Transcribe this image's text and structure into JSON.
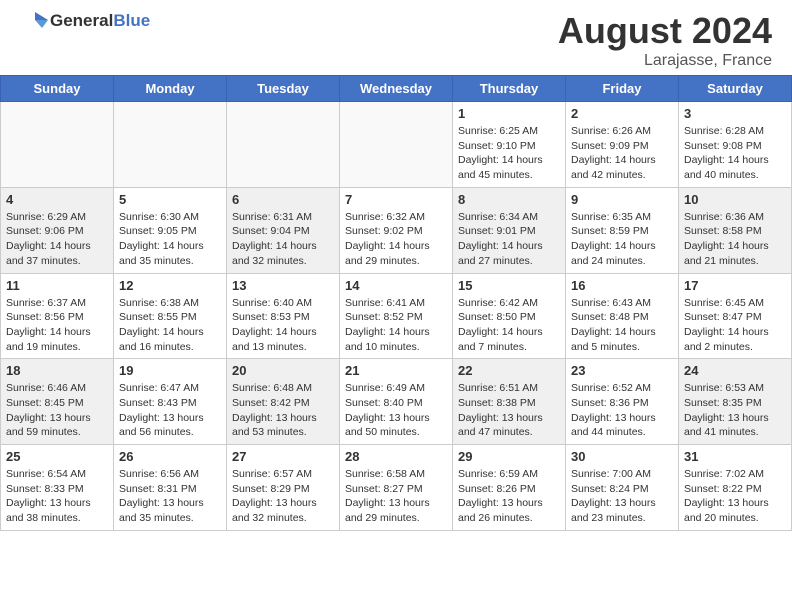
{
  "header": {
    "logo_general": "General",
    "logo_blue": "Blue",
    "month_year": "August 2024",
    "location": "Larajasse, France"
  },
  "days_of_week": [
    "Sunday",
    "Monday",
    "Tuesday",
    "Wednesday",
    "Thursday",
    "Friday",
    "Saturday"
  ],
  "weeks": [
    [
      {
        "day": "",
        "info": ""
      },
      {
        "day": "",
        "info": ""
      },
      {
        "day": "",
        "info": ""
      },
      {
        "day": "",
        "info": ""
      },
      {
        "day": "1",
        "info": "Sunrise: 6:25 AM\nSunset: 9:10 PM\nDaylight: 14 hours\nand 45 minutes."
      },
      {
        "day": "2",
        "info": "Sunrise: 6:26 AM\nSunset: 9:09 PM\nDaylight: 14 hours\nand 42 minutes."
      },
      {
        "day": "3",
        "info": "Sunrise: 6:28 AM\nSunset: 9:08 PM\nDaylight: 14 hours\nand 40 minutes."
      }
    ],
    [
      {
        "day": "4",
        "info": "Sunrise: 6:29 AM\nSunset: 9:06 PM\nDaylight: 14 hours\nand 37 minutes."
      },
      {
        "day": "5",
        "info": "Sunrise: 6:30 AM\nSunset: 9:05 PM\nDaylight: 14 hours\nand 35 minutes."
      },
      {
        "day": "6",
        "info": "Sunrise: 6:31 AM\nSunset: 9:04 PM\nDaylight: 14 hours\nand 32 minutes."
      },
      {
        "day": "7",
        "info": "Sunrise: 6:32 AM\nSunset: 9:02 PM\nDaylight: 14 hours\nand 29 minutes."
      },
      {
        "day": "8",
        "info": "Sunrise: 6:34 AM\nSunset: 9:01 PM\nDaylight: 14 hours\nand 27 minutes."
      },
      {
        "day": "9",
        "info": "Sunrise: 6:35 AM\nSunset: 8:59 PM\nDaylight: 14 hours\nand 24 minutes."
      },
      {
        "day": "10",
        "info": "Sunrise: 6:36 AM\nSunset: 8:58 PM\nDaylight: 14 hours\nand 21 minutes."
      }
    ],
    [
      {
        "day": "11",
        "info": "Sunrise: 6:37 AM\nSunset: 8:56 PM\nDaylight: 14 hours\nand 19 minutes."
      },
      {
        "day": "12",
        "info": "Sunrise: 6:38 AM\nSunset: 8:55 PM\nDaylight: 14 hours\nand 16 minutes."
      },
      {
        "day": "13",
        "info": "Sunrise: 6:40 AM\nSunset: 8:53 PM\nDaylight: 14 hours\nand 13 minutes."
      },
      {
        "day": "14",
        "info": "Sunrise: 6:41 AM\nSunset: 8:52 PM\nDaylight: 14 hours\nand 10 minutes."
      },
      {
        "day": "15",
        "info": "Sunrise: 6:42 AM\nSunset: 8:50 PM\nDaylight: 14 hours\nand 7 minutes."
      },
      {
        "day": "16",
        "info": "Sunrise: 6:43 AM\nSunset: 8:48 PM\nDaylight: 14 hours\nand 5 minutes."
      },
      {
        "day": "17",
        "info": "Sunrise: 6:45 AM\nSunset: 8:47 PM\nDaylight: 14 hours\nand 2 minutes."
      }
    ],
    [
      {
        "day": "18",
        "info": "Sunrise: 6:46 AM\nSunset: 8:45 PM\nDaylight: 13 hours\nand 59 minutes."
      },
      {
        "day": "19",
        "info": "Sunrise: 6:47 AM\nSunset: 8:43 PM\nDaylight: 13 hours\nand 56 minutes."
      },
      {
        "day": "20",
        "info": "Sunrise: 6:48 AM\nSunset: 8:42 PM\nDaylight: 13 hours\nand 53 minutes."
      },
      {
        "day": "21",
        "info": "Sunrise: 6:49 AM\nSunset: 8:40 PM\nDaylight: 13 hours\nand 50 minutes."
      },
      {
        "day": "22",
        "info": "Sunrise: 6:51 AM\nSunset: 8:38 PM\nDaylight: 13 hours\nand 47 minutes."
      },
      {
        "day": "23",
        "info": "Sunrise: 6:52 AM\nSunset: 8:36 PM\nDaylight: 13 hours\nand 44 minutes."
      },
      {
        "day": "24",
        "info": "Sunrise: 6:53 AM\nSunset: 8:35 PM\nDaylight: 13 hours\nand 41 minutes."
      }
    ],
    [
      {
        "day": "25",
        "info": "Sunrise: 6:54 AM\nSunset: 8:33 PM\nDaylight: 13 hours\nand 38 minutes."
      },
      {
        "day": "26",
        "info": "Sunrise: 6:56 AM\nSunset: 8:31 PM\nDaylight: 13 hours\nand 35 minutes."
      },
      {
        "day": "27",
        "info": "Sunrise: 6:57 AM\nSunset: 8:29 PM\nDaylight: 13 hours\nand 32 minutes."
      },
      {
        "day": "28",
        "info": "Sunrise: 6:58 AM\nSunset: 8:27 PM\nDaylight: 13 hours\nand 29 minutes."
      },
      {
        "day": "29",
        "info": "Sunrise: 6:59 AM\nSunset: 8:26 PM\nDaylight: 13 hours\nand 26 minutes."
      },
      {
        "day": "30",
        "info": "Sunrise: 7:00 AM\nSunset: 8:24 PM\nDaylight: 13 hours\nand 23 minutes."
      },
      {
        "day": "31",
        "info": "Sunrise: 7:02 AM\nSunset: 8:22 PM\nDaylight: 13 hours\nand 20 minutes."
      }
    ]
  ]
}
